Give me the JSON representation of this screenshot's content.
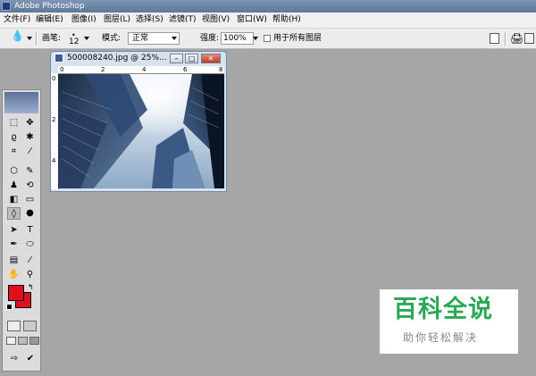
{
  "window": {
    "title": "Adobe Photoshop"
  },
  "menu": [
    "文件(F)",
    "编辑(E)",
    "图像(I)",
    "图层(L)",
    "选择(S)",
    "滤镜(T)",
    "视图(V)",
    "窗口(W)",
    "帮助(H)"
  ],
  "options": {
    "brush_label": "画笔:",
    "brush_size": "12",
    "mode_label": "模式:",
    "mode_value": "正常",
    "strength_label": "强度:",
    "strength_value": "100%",
    "all_layers_label": "用于所有图层"
  },
  "document": {
    "title": "500008240.jpg @ 25%...",
    "ruler_h": [
      "0",
      "2",
      "4",
      "6",
      "8"
    ],
    "ruler_v": [
      "0",
      "2",
      "4"
    ]
  },
  "colors": {
    "foreground": "#e0101e",
    "background": "#e0101e"
  },
  "watermark": {
    "title": "百科全说",
    "subtitle": "助你轻松解决"
  }
}
